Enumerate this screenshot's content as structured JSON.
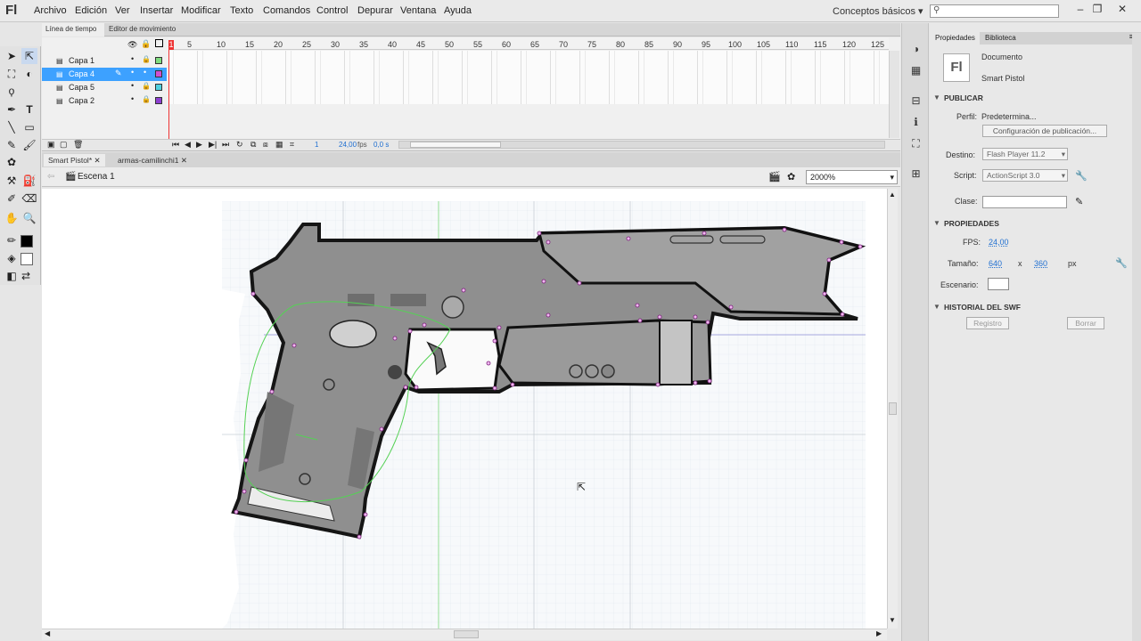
{
  "app": {
    "logo": "Fl"
  },
  "menu": [
    "Archivo",
    "Edición",
    "Ver",
    "Insertar",
    "Modificar",
    "Texto",
    "Comandos",
    "Control",
    "Depurar",
    "Ventana",
    "Ayuda"
  ],
  "workspace": "Conceptos básicos",
  "timeline": {
    "tabs": [
      "Línea de tiempo",
      "Editor de movimiento"
    ],
    "layers": [
      {
        "name": "Capa 1",
        "color": "#7fdc7f"
      },
      {
        "name": "Capa 4",
        "color": "#d04ed0"
      },
      {
        "name": "Capa 5",
        "color": "#4fd1e0"
      },
      {
        "name": "Capa 2",
        "color": "#8d3fd1"
      }
    ],
    "frame_numbers": [
      "5",
      "10",
      "15",
      "20",
      "25",
      "30",
      "35",
      "40",
      "45",
      "50",
      "55",
      "60",
      "65",
      "70",
      "75",
      "80",
      "85",
      "90",
      "95",
      "100",
      "105",
      "110",
      "115",
      "120",
      "125"
    ],
    "current_frame": "1",
    "fps": "24,00",
    "fps_unit": "fps",
    "time": "0,0 s"
  },
  "doc_tabs": [
    "Smart Pistol*",
    "armas-camilinchi1"
  ],
  "scene": "Escena 1",
  "zoom": "2000%",
  "properties": {
    "tabs": [
      "Propiedades",
      "Biblioteca"
    ],
    "doc_type": "Documento",
    "doc_name": "Smart Pistol",
    "doc_icon": "Fl",
    "publish_header": "PUBLICAR",
    "profile_label": "Perfil:",
    "profile_value": "Predetermina...",
    "publish_settings_button": "Configuración de publicación...",
    "target_label": "Destino:",
    "target_value": "Flash Player 11.2",
    "script_label": "Script:",
    "script_value": "ActionScript 3.0",
    "class_label": "Clase:",
    "props_header": "PROPIEDADES",
    "fps_label": "FPS:",
    "fps_value": "24,00",
    "size_label": "Tamaño:",
    "width_value": "640",
    "x_sep": "x",
    "height_value": "360",
    "size_unit": "px",
    "stage_label": "Escenario:",
    "history_header": "HISTORIAL DEL SWF",
    "log_button": "Registro",
    "clear_button": "Borrar"
  }
}
